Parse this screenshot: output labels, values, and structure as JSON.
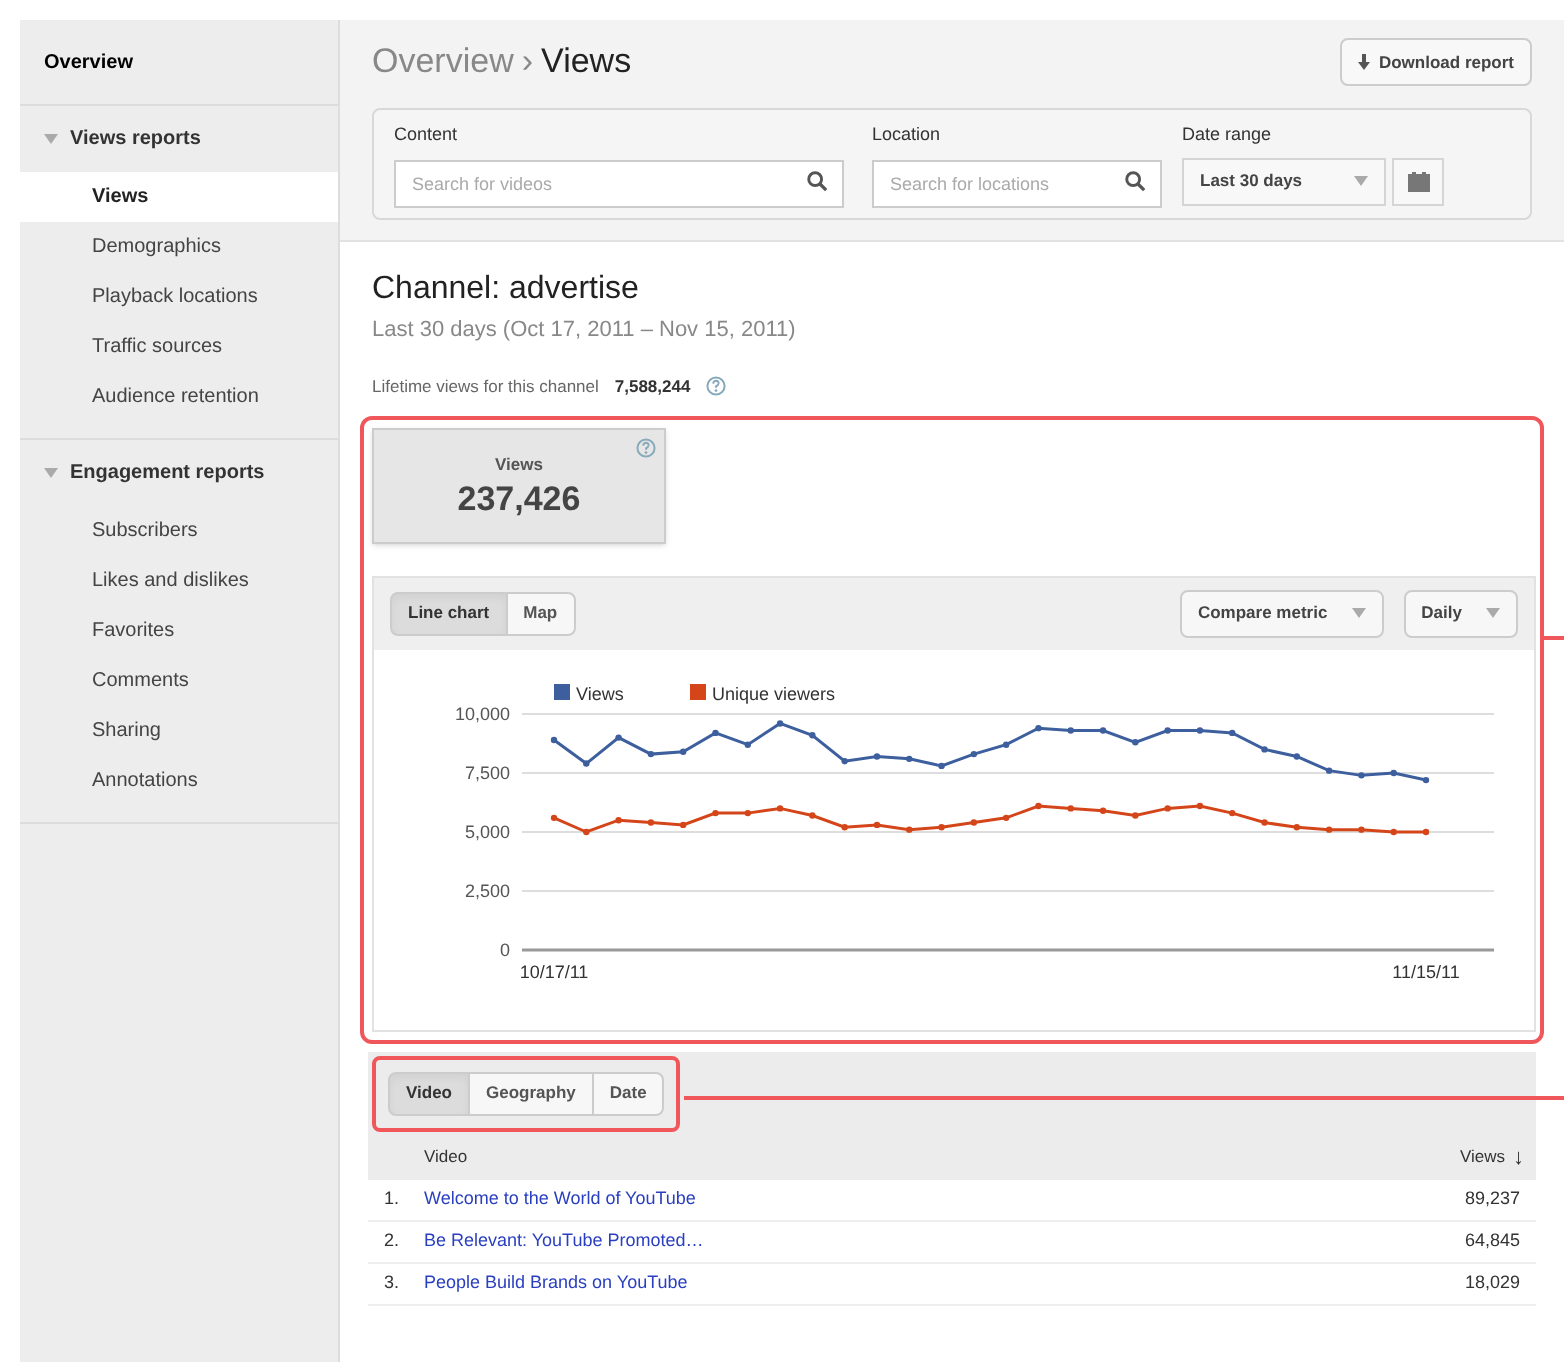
{
  "sidebar": {
    "top": {
      "label": "Overview",
      "selected": false
    },
    "sections": [
      {
        "label": "Views reports",
        "expanded": true,
        "items": [
          {
            "label": "Views",
            "selected": true
          },
          {
            "label": "Demographics",
            "selected": false
          },
          {
            "label": "Playback locations",
            "selected": false
          },
          {
            "label": "Traffic sources",
            "selected": false
          },
          {
            "label": "Audience retention",
            "selected": false
          }
        ]
      },
      {
        "label": "Engagement reports",
        "expanded": true,
        "items": [
          {
            "label": "Subscribers",
            "selected": false
          },
          {
            "label": "Likes and dislikes",
            "selected": false
          },
          {
            "label": "Favorites",
            "selected": false
          },
          {
            "label": "Comments",
            "selected": false
          },
          {
            "label": "Sharing",
            "selected": false
          },
          {
            "label": "Annotations",
            "selected": false
          }
        ]
      }
    ]
  },
  "breadcrumb": {
    "parent": "Overview",
    "separator": "›",
    "current": "Views"
  },
  "download_button": "Download report",
  "filters": {
    "content": {
      "label": "Content",
      "placeholder": "Search for videos"
    },
    "location": {
      "label": "Location",
      "placeholder": "Search for locations"
    },
    "date_range": {
      "label": "Date range",
      "value": "Last 30 days"
    }
  },
  "channel": {
    "title": "Channel: advertise",
    "subtitle": "Last 30 days (Oct 17, 2011 – Nov 15, 2011)",
    "lifetime_label": "Lifetime views for this channel",
    "lifetime_value": "7,588,244"
  },
  "metric_card": {
    "label": "Views",
    "value": "237,426"
  },
  "chart_toolbar": {
    "tabs": [
      {
        "label": "Line chart",
        "selected": true
      },
      {
        "label": "Map",
        "selected": false
      }
    ],
    "compare": "Compare metric",
    "interval": "Daily"
  },
  "chart_data": {
    "type": "line",
    "grid": true,
    "legend": true,
    "categories": [
      "10/17/11",
      null,
      null,
      null,
      null,
      null,
      null,
      null,
      null,
      null,
      null,
      null,
      null,
      null,
      null,
      null,
      null,
      null,
      null,
      null,
      null,
      null,
      null,
      null,
      null,
      null,
      null,
      "11/15/11"
    ],
    "ylim": [
      0,
      10000
    ],
    "yticks": [
      {
        "value": 0,
        "label": "0"
      },
      {
        "value": 2500,
        "label": "2,500"
      },
      {
        "value": 5000,
        "label": "5,000"
      },
      {
        "value": 7500,
        "label": "7,500"
      },
      {
        "value": 10000,
        "label": "10,000"
      }
    ],
    "series": [
      {
        "name": "Views",
        "color": "#3d5f9e",
        "marker": "circle",
        "values": [
          8900,
          7900,
          9000,
          8300,
          8400,
          9200,
          8700,
          9600,
          9100,
          8000,
          8200,
          8100,
          7800,
          8300,
          8700,
          9400,
          9300,
          9300,
          8800,
          9300,
          9300,
          9200,
          8500,
          8200,
          7600,
          7400,
          7500,
          7200
        ]
      },
      {
        "name": "Unique viewers",
        "color": "#d4461a",
        "marker": "circle",
        "values": [
          5600,
          5000,
          5500,
          5400,
          5300,
          5800,
          5800,
          6000,
          5700,
          5200,
          5300,
          5100,
          5200,
          5400,
          5600,
          6100,
          6000,
          5900,
          5700,
          6000,
          6100,
          5800,
          5400,
          5200,
          5100,
          5100,
          5000,
          5000
        ]
      }
    ]
  },
  "table_tabs": [
    {
      "label": "Video",
      "selected": true
    },
    {
      "label": "Geography",
      "selected": false
    },
    {
      "label": "Date",
      "selected": false
    }
  ],
  "table": {
    "columns": [
      "Video",
      "Views"
    ],
    "sort_indicator": "↓",
    "rows": [
      {
        "rank": "1.",
        "title": "Welcome to the World of YouTube",
        "views": "89,237"
      },
      {
        "rank": "2.",
        "title": "Be Relevant: YouTube Promoted…",
        "views": "64,845"
      },
      {
        "rank": "3.",
        "title": "People Build Brands on YouTube",
        "views": "18,029"
      }
    ]
  }
}
